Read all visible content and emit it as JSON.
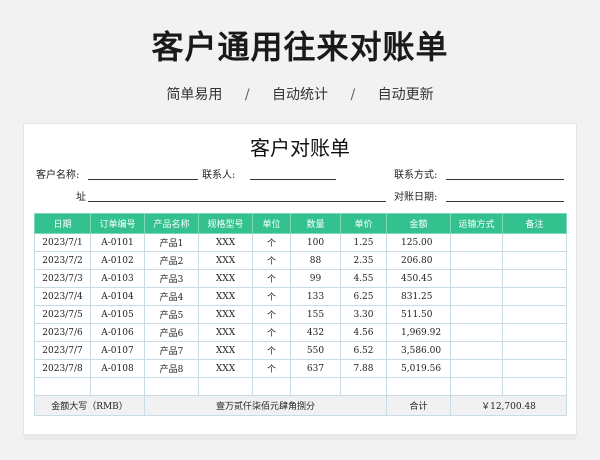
{
  "header": {
    "title": "客户通用往来对账单",
    "features": [
      "简单易用",
      "自动统计",
      "自动更新"
    ],
    "separator": "/"
  },
  "sheet": {
    "title": "客户对账单",
    "fields": {
      "customer_name": "客户名称:",
      "contact": "联系人:",
      "contact_method": "联系方式:",
      "address": "址",
      "statement_date": "对账日期:"
    },
    "columns": [
      "日期",
      "订单编号",
      "产品名称",
      "规格型号",
      "单位",
      "数量",
      "单价",
      "金额",
      "运输方式",
      "备注"
    ],
    "rows": [
      [
        "2023/7/1",
        "A-0101",
        "产品1",
        "XXX",
        "个",
        "100",
        "1.25",
        "125.00",
        "",
        ""
      ],
      [
        "2023/7/2",
        "A-0102",
        "产品2",
        "XXX",
        "个",
        "88",
        "2.35",
        "206.80",
        "",
        ""
      ],
      [
        "2023/7/3",
        "A-0103",
        "产品3",
        "XXX",
        "个",
        "99",
        "4.55",
        "450.45",
        "",
        ""
      ],
      [
        "2023/7/4",
        "A-0104",
        "产品4",
        "XXX",
        "个",
        "133",
        "6.25",
        "831.25",
        "",
        ""
      ],
      [
        "2023/7/5",
        "A-0105",
        "产品5",
        "XXX",
        "个",
        "155",
        "3.30",
        "511.50",
        "",
        ""
      ],
      [
        "2023/7/6",
        "A-0106",
        "产品6",
        "XXX",
        "个",
        "432",
        "4.56",
        "1,969.92",
        "",
        ""
      ],
      [
        "2023/7/7",
        "A-0107",
        "产品7",
        "XXX",
        "个",
        "550",
        "6.52",
        "3,586.00",
        "",
        ""
      ],
      [
        "2023/7/8",
        "A-0108",
        "产品8",
        "XXX",
        "个",
        "637",
        "7.88",
        "5,019.56",
        "",
        ""
      ],
      [
        "",
        "",
        "",
        "",
        "",
        "",
        "",
        "",
        "",
        ""
      ]
    ],
    "total": {
      "amount_words_label": "金额大写（RMB）",
      "amount_words": "壹万贰仟柒佰元肆角捌分",
      "sum_label": "合计",
      "sum_value": "￥12,700.48"
    }
  },
  "colors": {
    "accent": "#33c28f",
    "grid_line": "#c9dce6"
  }
}
